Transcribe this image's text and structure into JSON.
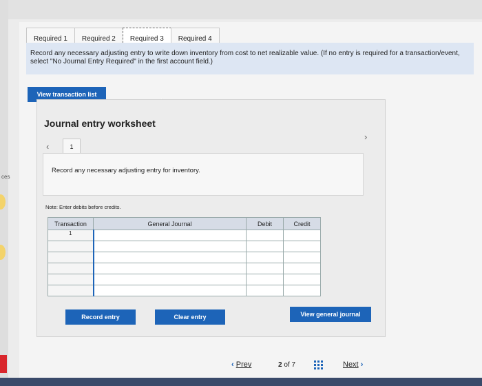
{
  "left_cut_text": "ces",
  "tabs": [
    {
      "label": "Required 1"
    },
    {
      "label": "Required 2"
    },
    {
      "label": "Required 3"
    },
    {
      "label": "Required 4"
    }
  ],
  "instructions": "Record any necessary adjusting entry to write down inventory from cost to net realizable value. (If no entry is required for a transaction/event, select \"No Journal Entry Required\" in the first account field.)",
  "view_transaction_list_label": "View transaction list",
  "worksheet": {
    "title": "Journal entry worksheet",
    "step": "1",
    "description": "Record any necessary adjusting entry for inventory.",
    "note": "Note: Enter debits before credits.",
    "columns": {
      "transaction": "Transaction",
      "general_journal": "General Journal",
      "debit": "Debit",
      "credit": "Credit"
    },
    "rows": [
      {
        "transaction": "1",
        "account": "",
        "debit": "",
        "credit": ""
      },
      {
        "transaction": "",
        "account": "",
        "debit": "",
        "credit": ""
      },
      {
        "transaction": "",
        "account": "",
        "debit": "",
        "credit": ""
      },
      {
        "transaction": "",
        "account": "",
        "debit": "",
        "credit": ""
      },
      {
        "transaction": "",
        "account": "",
        "debit": "",
        "credit": ""
      },
      {
        "transaction": "",
        "account": "",
        "debit": "",
        "credit": ""
      }
    ],
    "record_entry_label": "Record entry",
    "clear_entry_label": "Clear entry",
    "view_general_journal_label": "View general journal"
  },
  "pager": {
    "prev_label": "Prev",
    "current": "2",
    "of_label": "of",
    "total": "7",
    "next_label": "Next"
  },
  "colors": {
    "accent": "#1d64b8",
    "instruction_bg": "#dde6f3",
    "header_bg": "#d6dce6"
  },
  "icons": [
    "chevron-left-icon",
    "chevron-right-icon",
    "grid-icon",
    "cursor-icon"
  ]
}
